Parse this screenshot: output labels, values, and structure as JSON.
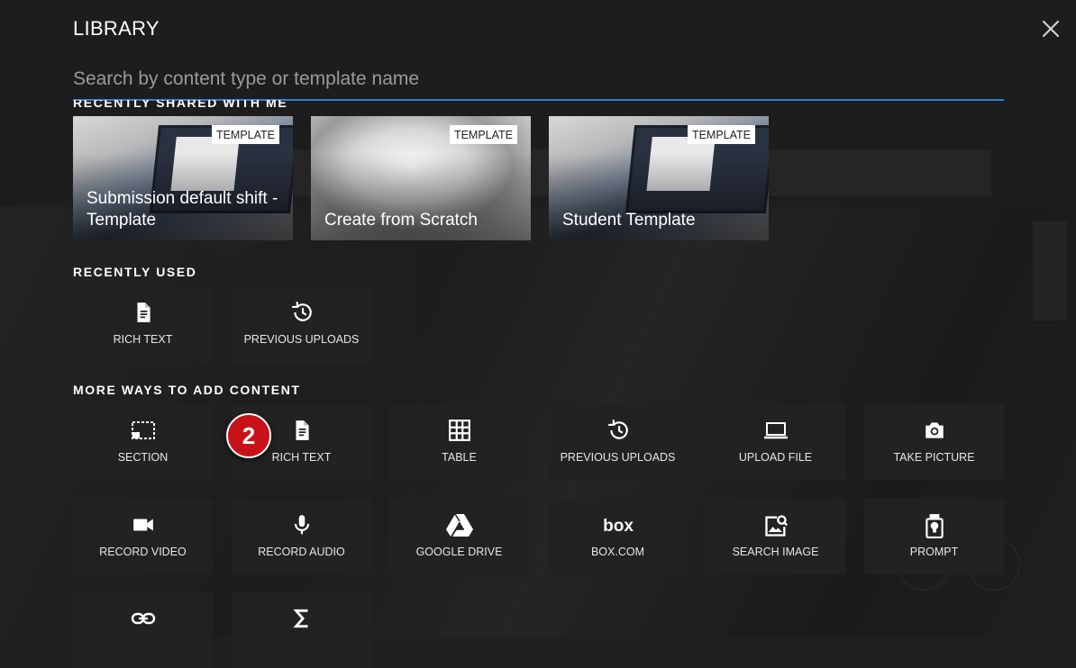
{
  "library": {
    "title": "LIBRARY",
    "close_icon": "close-icon",
    "search": {
      "placeholder": "Search by content type or template name",
      "value": ""
    }
  },
  "recently_shared": {
    "label": "RECENTLY SHARED WITH ME",
    "templates": [
      {
        "name": "Submission default shift - Template",
        "badge": "TEMPLATE",
        "image": "laptop-photo"
      },
      {
        "name": "Create from Scratch",
        "badge": "TEMPLATE",
        "image": "paper-photo"
      },
      {
        "name": "Student Template",
        "badge": "TEMPLATE",
        "image": "laptop-photo"
      }
    ]
  },
  "recently_used": {
    "label": "RECENTLY USED",
    "items": [
      {
        "label": "RICH TEXT",
        "icon": "document-icon"
      },
      {
        "label": "PREVIOUS UPLOADS",
        "icon": "history-icon"
      }
    ]
  },
  "more_ways": {
    "label": "MORE WAYS TO ADD CONTENT",
    "items": [
      {
        "label": "SECTION",
        "icon": "section-icon"
      },
      {
        "label": "RICH TEXT",
        "icon": "document-icon"
      },
      {
        "label": "TABLE",
        "icon": "table-icon"
      },
      {
        "label": "PREVIOUS UPLOADS",
        "icon": "history-icon"
      },
      {
        "label": "UPLOAD FILE",
        "icon": "laptop-icon"
      },
      {
        "label": "TAKE PICTURE",
        "icon": "camera-icon"
      },
      {
        "label": "RECORD VIDEO",
        "icon": "video-camera-icon"
      },
      {
        "label": "RECORD AUDIO",
        "icon": "microphone-icon"
      },
      {
        "label": "GOOGLE DRIVE",
        "icon": "google-drive-icon"
      },
      {
        "label": "BOX.COM",
        "icon": "box-logo-icon"
      },
      {
        "label": "SEARCH IMAGE",
        "icon": "image-search-icon"
      },
      {
        "label": "PROMPT",
        "icon": "prompt-icon"
      },
      {
        "label": "",
        "icon": "link-icon"
      },
      {
        "label": "",
        "icon": "sigma-icon"
      }
    ]
  },
  "step_badge": "2",
  "colors": {
    "accent": "#2f7fd6",
    "tile_bg": "#222222",
    "badge_red": "#c8121a"
  }
}
